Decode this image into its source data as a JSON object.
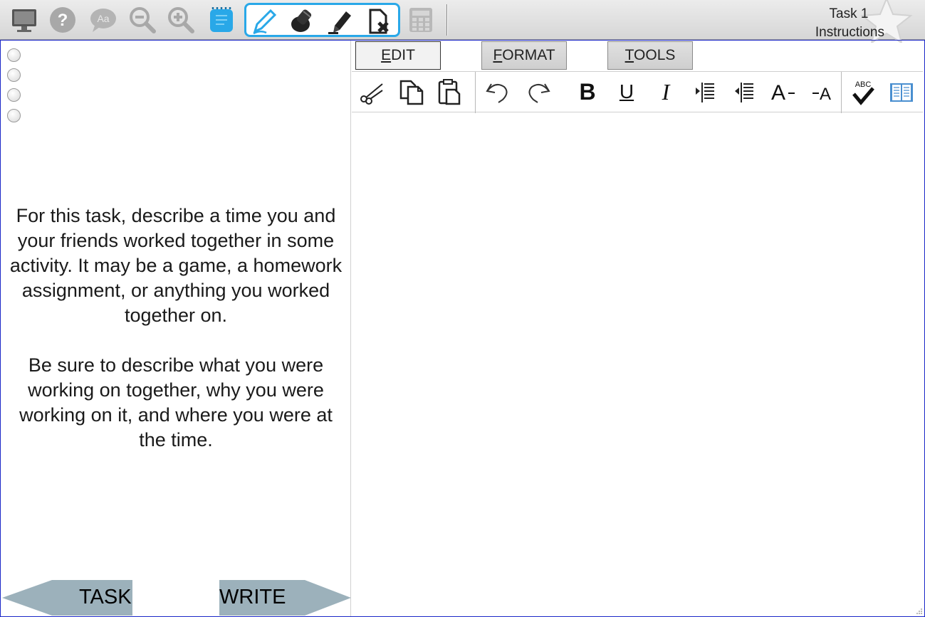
{
  "toolbar": {
    "left_icons": [
      "monitor-icon",
      "help-icon",
      "text-to-speech-icon",
      "zoom-out-icon",
      "zoom-in-icon",
      "notepad-icon"
    ],
    "tool_group_icons": [
      "pen-icon",
      "eraser-icon",
      "highlighter-icon",
      "clear-marks-icon"
    ],
    "calculator_icon": "calculator-icon",
    "task_title": "Task 1",
    "task_subtitle": "Instructions",
    "accent_color": "#29a8e8"
  },
  "left_pane": {
    "radio_count": 4,
    "prompt_paragraph_1": "For this task, describe a time you and your friends worked together in some activity. It may be a game, a homework assignment, or anything you worked together on.",
    "prompt_paragraph_2": "Be sure to describe what you were working on together, why you were working on it, and where you were at the time.",
    "nav_back_label": "TASK",
    "nav_next_label": "WRITE"
  },
  "editor": {
    "menus": [
      {
        "first": "E",
        "rest": "DIT"
      },
      {
        "first": "F",
        "rest": "ORMAT"
      },
      {
        "first": "T",
        "rest": "OOLS"
      }
    ],
    "format_buttons": [
      "cut-icon",
      "copy-icon",
      "paste-icon",
      "undo-icon",
      "redo-icon",
      "bold-button",
      "underline-button",
      "italic-button",
      "indent-icon",
      "outdent-icon",
      "increase-font-icon",
      "decrease-font-icon",
      "spellcheck-icon",
      "dictionary-icon"
    ],
    "bold_glyph": "B",
    "underline_glyph": "U",
    "italic_glyph": "I",
    "spell_label": "ABC",
    "response_text": ""
  }
}
